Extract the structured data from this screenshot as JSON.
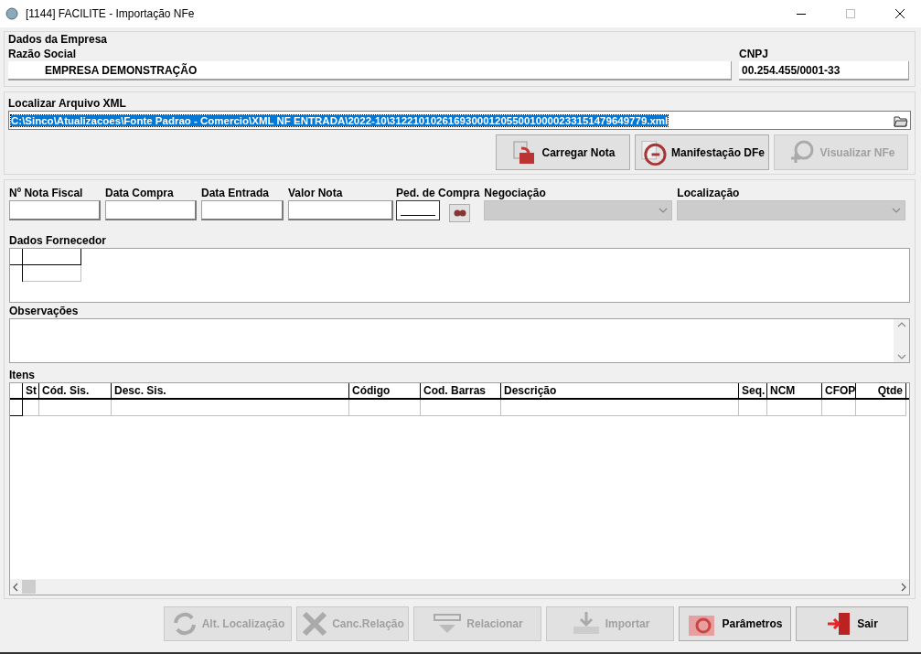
{
  "window": {
    "title": "[1144] FACILITE - Importação NFe"
  },
  "empresa": {
    "title": "Dados da Empresa",
    "razao_label": "Razão Social",
    "razao_value": "EMPRESA DEMONSTRAÇÃO",
    "cnpj_label": "CNPJ",
    "cnpj_value": "00.254.455/0001-33"
  },
  "xml": {
    "label": "Localizar Arquivo XML",
    "value": "C:\\Sinco\\Atualizacoes\\Fonte Padrao - Comercio\\XML NF ENTRADA\\2022-10\\31221010261693000120550010000233151479649779.xml",
    "selected": true
  },
  "xml_buttons": [
    {
      "label": "Carregar Nota",
      "disabled": false
    },
    {
      "label": "Manifestação DFe",
      "disabled": false
    },
    {
      "label": "Visualizar NFe",
      "disabled": true
    }
  ],
  "fields": [
    {
      "label": "Nº Nota Fiscal",
      "kind": "text"
    },
    {
      "label": "Data Compra",
      "kind": "text"
    },
    {
      "label": "Data Entrada",
      "kind": "text"
    },
    {
      "label": "Valor Nota",
      "kind": "text"
    },
    {
      "label": "Ped. de Compra",
      "kind": "lookup"
    },
    {
      "label": "Negociação",
      "kind": "combo",
      "disabled": true
    },
    {
      "label": "Localização",
      "kind": "combo",
      "disabled": true
    }
  ],
  "fornecedor": {
    "label": "Dados Fornecedor"
  },
  "observacoes": {
    "label": "Observações"
  },
  "itens": {
    "label": "Itens",
    "columns": [
      "St",
      "Cód. Sis.",
      "Desc. Sis.",
      "Código",
      "Cod. Barras",
      "Descrição",
      "Seq.",
      "NCM",
      "CFOP",
      "Qtde"
    ]
  },
  "buttons": [
    {
      "label": "Alt. Localização",
      "disabled": true
    },
    {
      "label": "Canc.Relação",
      "disabled": true
    },
    {
      "label": "Relacionar",
      "disabled": true
    },
    {
      "label": "Importar",
      "disabled": true
    },
    {
      "label": "Parâmetros",
      "disabled": false
    },
    {
      "label": "Sair",
      "disabled": false
    }
  ]
}
